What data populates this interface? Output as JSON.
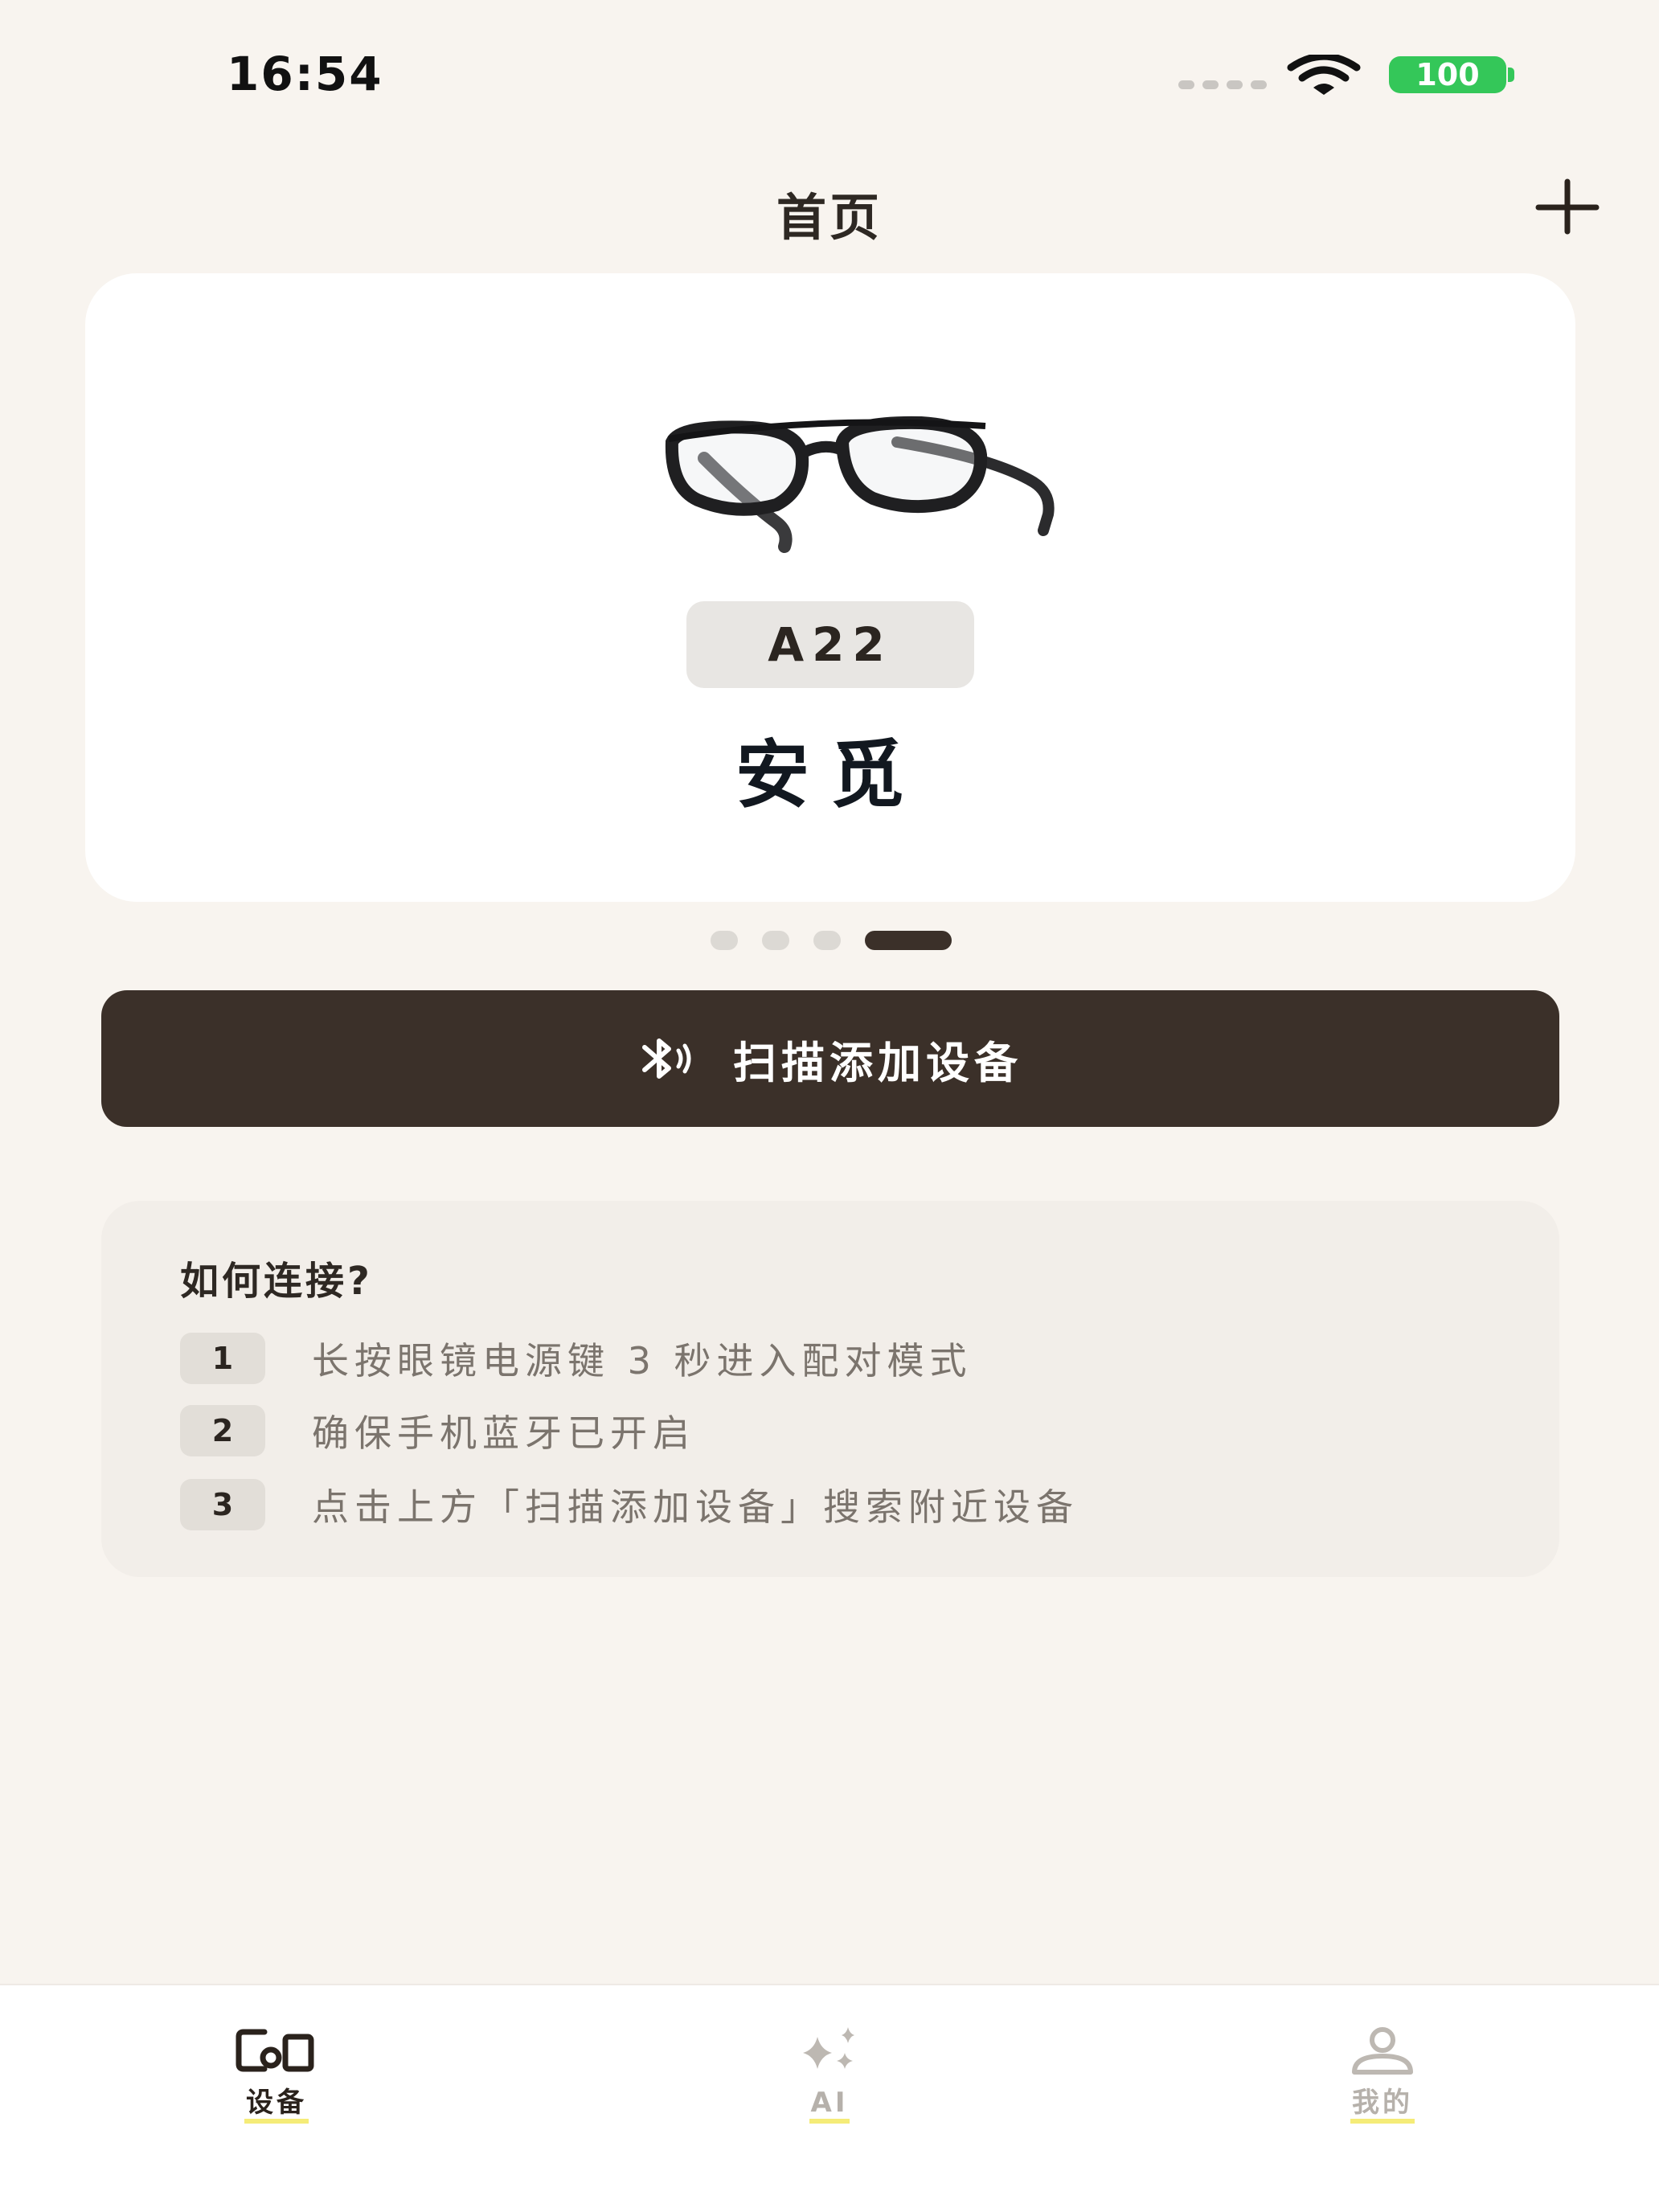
{
  "status_bar": {
    "time": "16:54",
    "battery": "100",
    "battery_color": "#34c759"
  },
  "header": {
    "title": "首页",
    "add_icon": "plus-icon"
  },
  "device_card": {
    "image": "smart-glasses",
    "model": "A22",
    "name": "安觅"
  },
  "carousel": {
    "page_count": 4,
    "active_index": 3
  },
  "scan_button": {
    "icon": "bluetooth-icon",
    "label": "扫描添加设备",
    "color": "#3b3029"
  },
  "help": {
    "title": "如何连接?",
    "steps": [
      {
        "num": "1",
        "text": "长按眼镜电源键 3 秒进入配对模式"
      },
      {
        "num": "2",
        "text": "确保手机蓝牙已开启"
      },
      {
        "num": "3",
        "text": "点击上方「扫描添加设备」搜索附近设备"
      }
    ]
  },
  "tab_bar": {
    "tabs": [
      {
        "label": "设备",
        "icon": "devices-icon",
        "active": true
      },
      {
        "label": "AI",
        "icon": "sparkle-icon",
        "active": false
      },
      {
        "label": "我的",
        "icon": "user-icon",
        "active": false
      }
    ],
    "highlight_color": "#f5ec78"
  }
}
